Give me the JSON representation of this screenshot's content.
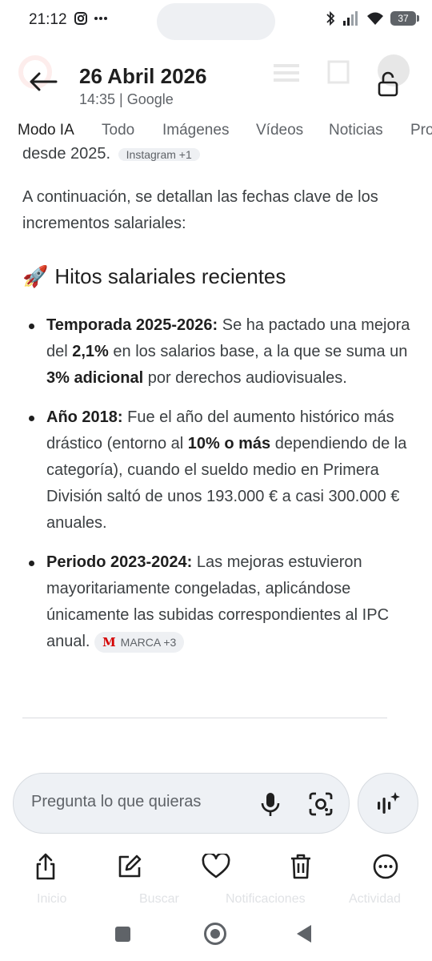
{
  "status_bar": {
    "time": "21:12",
    "battery": "37",
    "icons": [
      "instagram-icon",
      "more-dots-icon",
      "bluetooth-icon",
      "signal-icon",
      "wifi-icon",
      "battery-icon"
    ]
  },
  "header": {
    "title": "26 Abril 2026",
    "subtitle": "14:35 | Google"
  },
  "tabs": [
    {
      "label": "Modo IA",
      "active": true
    },
    {
      "label": "Todo",
      "active": false
    },
    {
      "label": "Imágenes",
      "active": false
    },
    {
      "label": "Vídeos",
      "active": false
    },
    {
      "label": "Noticias",
      "active": false
    },
    {
      "label": "Pro",
      "active": false
    }
  ],
  "content": {
    "cut_line_text": "desde 2025.",
    "cut_line_chip": "Instagram +1",
    "intro": "A continuación, se detallan las fechas clave de los incrementos salariales:",
    "section_emoji": "🚀",
    "section_title": "Hitos salariales recientes",
    "bullets": [
      {
        "label": "Temporada 2025-2026:",
        "t1": " Se ha pactado una mejora del ",
        "b1": "2,1%",
        "t2": " en los salarios base, a la que se suma un ",
        "b2": "3% adicional",
        "t3": " por derechos audiovisuales."
      },
      {
        "label": "Año 2018:",
        "t1": " Fue el año del aumento histórico más drástico (entorno al ",
        "b1": "10% o más",
        "t2": " dependiendo de la categoría), cuando el sueldo medio en Primera División saltó de unos 193.000 € a casi 300.000 € anuales."
      },
      {
        "label": "Periodo 2023-2024:",
        "t1": " Las mejoras estuvieron mayoritariamente congeladas, aplicándose únicamente las subidas correspondientes al IPC anual. ",
        "chip_logo": "M",
        "chip_text": "MARCA +3"
      }
    ]
  },
  "input_bar": {
    "placeholder": "Pregunta lo que quieras"
  },
  "ghost_labels": [
    "Inicio",
    "Buscar",
    "Notificaciones",
    "Actividad"
  ]
}
